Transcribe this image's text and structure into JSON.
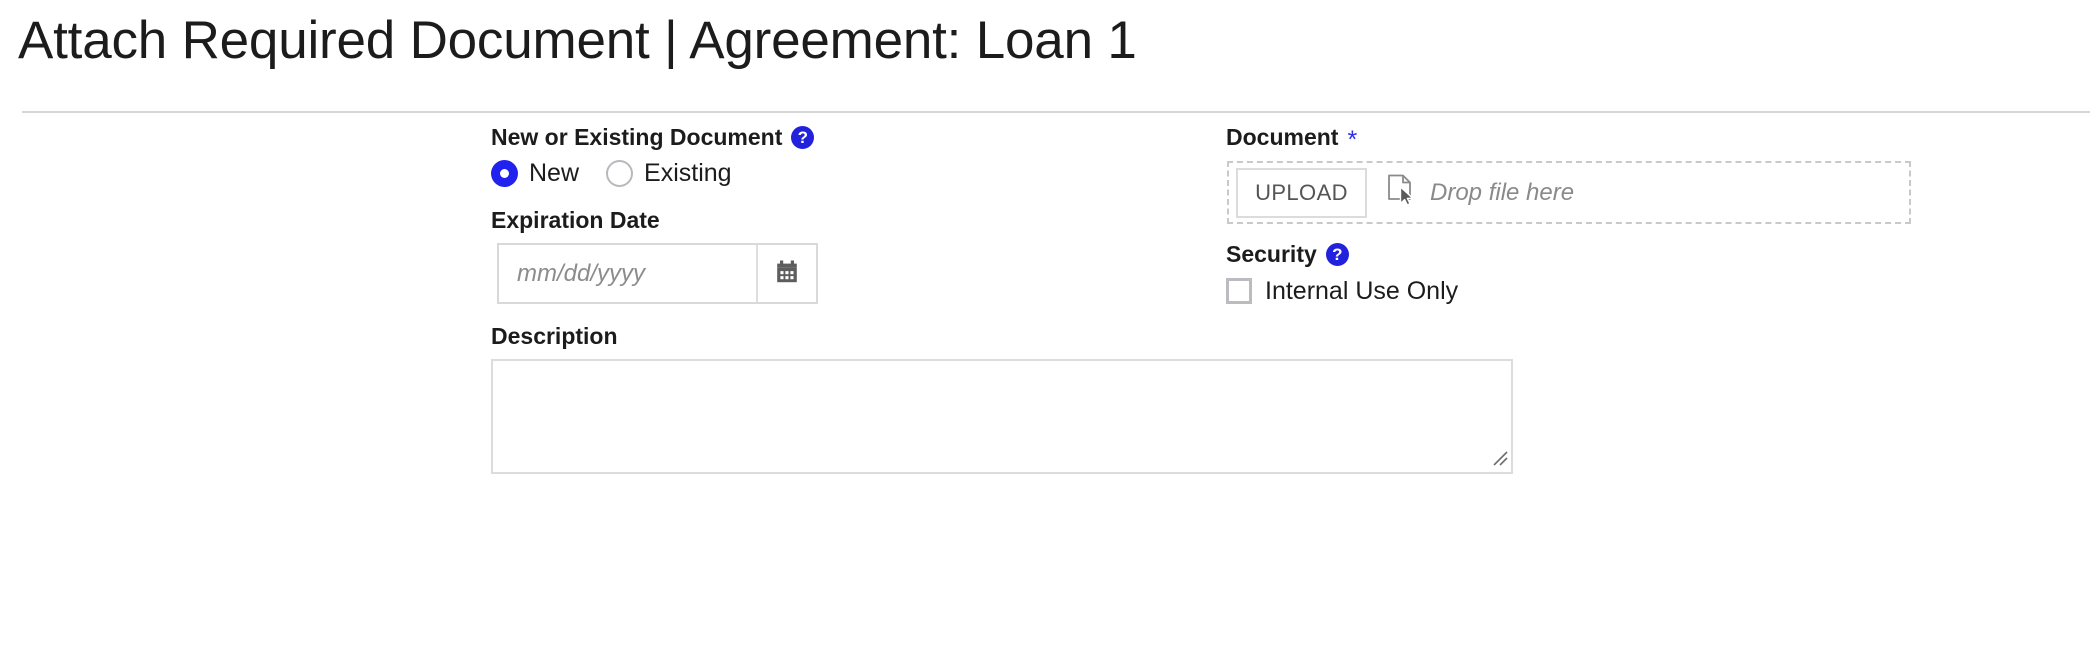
{
  "header": {
    "title": "Attach Required Document | Agreement: Loan 1"
  },
  "form": {
    "new_or_existing": {
      "label": "New or Existing Document",
      "help_icon": "help-circle-icon",
      "help_glyph": "?",
      "options": [
        {
          "label": "New",
          "selected": true
        },
        {
          "label": "Existing",
          "selected": false
        }
      ]
    },
    "expiration_date": {
      "label": "Expiration Date",
      "value": "",
      "placeholder": "mm/dd/yyyy",
      "calendar_icon": "calendar-icon"
    },
    "description": {
      "label": "Description",
      "value": "",
      "placeholder": ""
    },
    "document": {
      "label": "Document",
      "required_marker": "*",
      "upload_button": "UPLOAD",
      "drop_text": "Drop file here",
      "drop_icon": "file-cursor-icon"
    },
    "security": {
      "label": "Security",
      "help_icon": "help-circle-icon",
      "help_glyph": "?",
      "checkbox": {
        "label": "Internal Use Only",
        "checked": false
      }
    }
  },
  "colors": {
    "accent_blue": "#2222ee",
    "required_blue": "#2d2df0",
    "border_gray": "#d9d9d9",
    "dashed_gray": "#c9c9c9",
    "placeholder_gray": "#8c8c8c",
    "text_dark": "#1c1c1c"
  }
}
